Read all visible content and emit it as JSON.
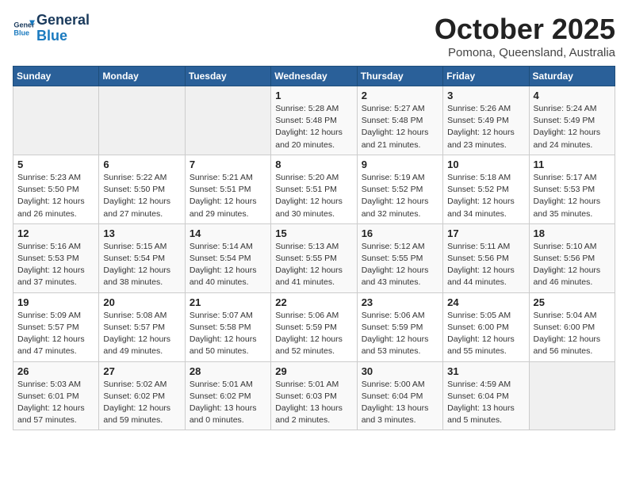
{
  "header": {
    "logo_line1": "General",
    "logo_line2": "Blue",
    "title": "October 2025",
    "subtitle": "Pomona, Queensland, Australia"
  },
  "days_of_week": [
    "Sunday",
    "Monday",
    "Tuesday",
    "Wednesday",
    "Thursday",
    "Friday",
    "Saturday"
  ],
  "weeks": [
    [
      {
        "day": "",
        "info": ""
      },
      {
        "day": "",
        "info": ""
      },
      {
        "day": "",
        "info": ""
      },
      {
        "day": "1",
        "info": "Sunrise: 5:28 AM\nSunset: 5:48 PM\nDaylight: 12 hours\nand 20 minutes."
      },
      {
        "day": "2",
        "info": "Sunrise: 5:27 AM\nSunset: 5:48 PM\nDaylight: 12 hours\nand 21 minutes."
      },
      {
        "day": "3",
        "info": "Sunrise: 5:26 AM\nSunset: 5:49 PM\nDaylight: 12 hours\nand 23 minutes."
      },
      {
        "day": "4",
        "info": "Sunrise: 5:24 AM\nSunset: 5:49 PM\nDaylight: 12 hours\nand 24 minutes."
      }
    ],
    [
      {
        "day": "5",
        "info": "Sunrise: 5:23 AM\nSunset: 5:50 PM\nDaylight: 12 hours\nand 26 minutes."
      },
      {
        "day": "6",
        "info": "Sunrise: 5:22 AM\nSunset: 5:50 PM\nDaylight: 12 hours\nand 27 minutes."
      },
      {
        "day": "7",
        "info": "Sunrise: 5:21 AM\nSunset: 5:51 PM\nDaylight: 12 hours\nand 29 minutes."
      },
      {
        "day": "8",
        "info": "Sunrise: 5:20 AM\nSunset: 5:51 PM\nDaylight: 12 hours\nand 30 minutes."
      },
      {
        "day": "9",
        "info": "Sunrise: 5:19 AM\nSunset: 5:52 PM\nDaylight: 12 hours\nand 32 minutes."
      },
      {
        "day": "10",
        "info": "Sunrise: 5:18 AM\nSunset: 5:52 PM\nDaylight: 12 hours\nand 34 minutes."
      },
      {
        "day": "11",
        "info": "Sunrise: 5:17 AM\nSunset: 5:53 PM\nDaylight: 12 hours\nand 35 minutes."
      }
    ],
    [
      {
        "day": "12",
        "info": "Sunrise: 5:16 AM\nSunset: 5:53 PM\nDaylight: 12 hours\nand 37 minutes."
      },
      {
        "day": "13",
        "info": "Sunrise: 5:15 AM\nSunset: 5:54 PM\nDaylight: 12 hours\nand 38 minutes."
      },
      {
        "day": "14",
        "info": "Sunrise: 5:14 AM\nSunset: 5:54 PM\nDaylight: 12 hours\nand 40 minutes."
      },
      {
        "day": "15",
        "info": "Sunrise: 5:13 AM\nSunset: 5:55 PM\nDaylight: 12 hours\nand 41 minutes."
      },
      {
        "day": "16",
        "info": "Sunrise: 5:12 AM\nSunset: 5:55 PM\nDaylight: 12 hours\nand 43 minutes."
      },
      {
        "day": "17",
        "info": "Sunrise: 5:11 AM\nSunset: 5:56 PM\nDaylight: 12 hours\nand 44 minutes."
      },
      {
        "day": "18",
        "info": "Sunrise: 5:10 AM\nSunset: 5:56 PM\nDaylight: 12 hours\nand 46 minutes."
      }
    ],
    [
      {
        "day": "19",
        "info": "Sunrise: 5:09 AM\nSunset: 5:57 PM\nDaylight: 12 hours\nand 47 minutes."
      },
      {
        "day": "20",
        "info": "Sunrise: 5:08 AM\nSunset: 5:57 PM\nDaylight: 12 hours\nand 49 minutes."
      },
      {
        "day": "21",
        "info": "Sunrise: 5:07 AM\nSunset: 5:58 PM\nDaylight: 12 hours\nand 50 minutes."
      },
      {
        "day": "22",
        "info": "Sunrise: 5:06 AM\nSunset: 5:59 PM\nDaylight: 12 hours\nand 52 minutes."
      },
      {
        "day": "23",
        "info": "Sunrise: 5:06 AM\nSunset: 5:59 PM\nDaylight: 12 hours\nand 53 minutes."
      },
      {
        "day": "24",
        "info": "Sunrise: 5:05 AM\nSunset: 6:00 PM\nDaylight: 12 hours\nand 55 minutes."
      },
      {
        "day": "25",
        "info": "Sunrise: 5:04 AM\nSunset: 6:00 PM\nDaylight: 12 hours\nand 56 minutes."
      }
    ],
    [
      {
        "day": "26",
        "info": "Sunrise: 5:03 AM\nSunset: 6:01 PM\nDaylight: 12 hours\nand 57 minutes."
      },
      {
        "day": "27",
        "info": "Sunrise: 5:02 AM\nSunset: 6:02 PM\nDaylight: 12 hours\nand 59 minutes."
      },
      {
        "day": "28",
        "info": "Sunrise: 5:01 AM\nSunset: 6:02 PM\nDaylight: 13 hours\nand 0 minutes."
      },
      {
        "day": "29",
        "info": "Sunrise: 5:01 AM\nSunset: 6:03 PM\nDaylight: 13 hours\nand 2 minutes."
      },
      {
        "day": "30",
        "info": "Sunrise: 5:00 AM\nSunset: 6:04 PM\nDaylight: 13 hours\nand 3 minutes."
      },
      {
        "day": "31",
        "info": "Sunrise: 4:59 AM\nSunset: 6:04 PM\nDaylight: 13 hours\nand 5 minutes."
      },
      {
        "day": "",
        "info": ""
      }
    ]
  ]
}
